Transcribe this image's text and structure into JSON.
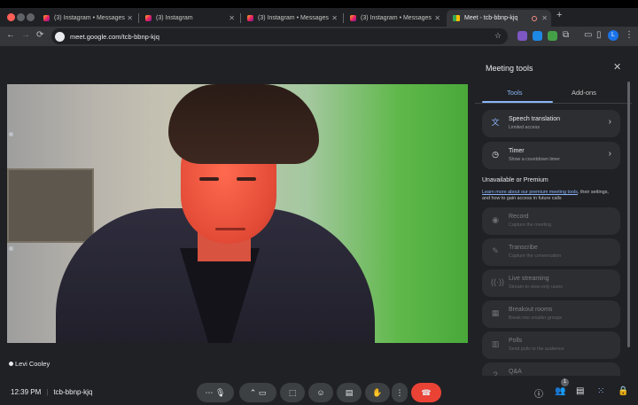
{
  "tabs": [
    {
      "label": "(3) Instagram • Messages"
    },
    {
      "label": "(3) Instagram"
    },
    {
      "label": "(3) Instagram • Messages"
    },
    {
      "label": "(3) Instagram • Messages"
    },
    {
      "label": "Meet - tcb-bbnp-kjq"
    }
  ],
  "url": "meet.google.com/tcb-bbnp-kjq",
  "profile_initial": "L",
  "participant": {
    "name": "Levi Cooley"
  },
  "footer": {
    "time": "12:39 PM",
    "meeting_code": "tcb-bbnp-kjq",
    "people_badge": "1"
  },
  "panel": {
    "title": "Meeting tools",
    "tabs": [
      "Tools",
      "Add-ons"
    ],
    "available": [
      {
        "title": "Speech translation",
        "subtitle": "Limited access"
      },
      {
        "title": "Timer",
        "subtitle": "Show a countdown timer"
      }
    ],
    "section_header": "Unavailable or Premium",
    "learn_link": "Learn more about our premium meeting tools",
    "learn_rest": ", their settings, and how to gain access in future calls",
    "unavailable": [
      {
        "title": "Record",
        "subtitle": "Capture the meeting"
      },
      {
        "title": "Transcribe",
        "subtitle": "Capture the conversation"
      },
      {
        "title": "Live streaming",
        "subtitle": "Stream to view-only users"
      },
      {
        "title": "Breakout rooms",
        "subtitle": "Break into smaller groups"
      },
      {
        "title": "Polls",
        "subtitle": "Send polls to the audience"
      },
      {
        "title": "Q&A",
        "subtitle": ""
      }
    ]
  },
  "colors": {
    "accent": "#8ab4f8",
    "end_call": "#ea4335",
    "panel": "#202124"
  }
}
